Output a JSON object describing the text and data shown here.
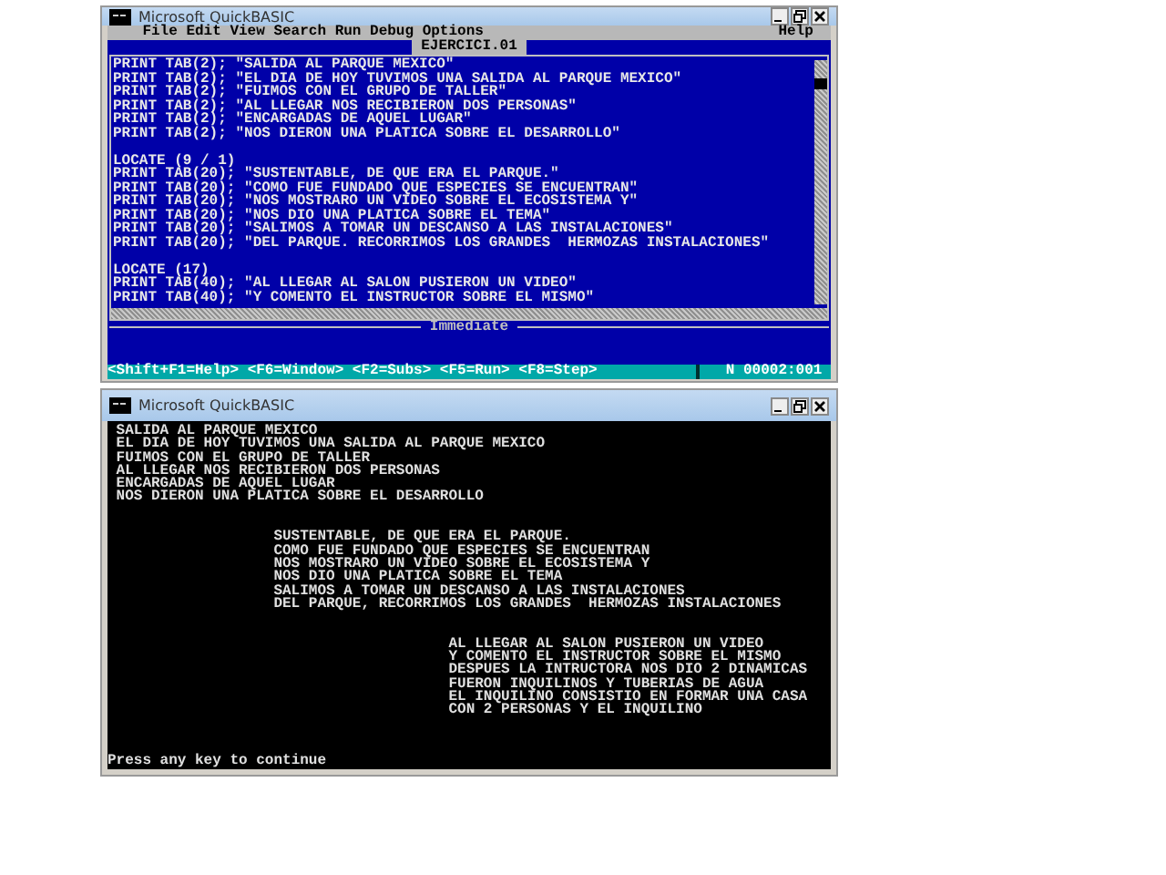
{
  "editor_window": {
    "title": "Microsoft QuickBASIC",
    "menu": [
      "File",
      "Edit",
      "View",
      "Search",
      "Run",
      "Debug",
      "Options"
    ],
    "help_menu": "Help",
    "file_tab": "EJERCICI.01",
    "code_blocks": [
      [
        "PRINT TAB(2); \"SALIDA AL PARQUE MEXICO\"",
        "PRINT TAB(2); \"EL DIA DE HOY TUVIMOS UNA SALIDA AL PARQUE MEXICO\"",
        "PRINT TAB(2); \"FUIMOS CON EL GRUPO DE TALLER\"",
        "PRINT TAB(2); \"AL LLEGAR NOS RECIBIERON DOS PERSONAS\"",
        "PRINT TAB(2); \"ENCARGADAS DE AQUEL LUGAR\"",
        "PRINT TAB(2); \"NOS DIERON UNA PLATICA SOBRE EL DESARROLLO\""
      ],
      [
        "LOCATE (9 / 1)",
        "PRINT TAB(20); \"SUSTENTABLE, DE QUE ERA EL PARQUE.\"",
        "PRINT TAB(20); \"COMO FUE FUNDADO QUE ESPECIES SE ENCUENTRAN\"",
        "PRINT TAB(20); \"NOS MOSTRARO UN VIDEO SOBRE EL ECOSISTEMA Y\"",
        "PRINT TAB(20); \"NOS DIO UNA PLATICA SOBRE EL TEMA\"",
        "PRINT TAB(20); \"SALIMOS A TOMAR UN DESCANSO A LAS INSTALACIONES\"",
        "PRINT TAB(20); \"DEL PARQUE. RECORRIMOS LOS GRANDES  HERMOZAS INSTALACIONES\""
      ],
      [
        "LOCATE (17)",
        "PRINT TAB(40); \"AL LLEGAR AL SALON PUSIERON UN VIDEO\"",
        "PRINT TAB(40); \"Y COMENTO EL INSTRUCTOR SOBRE EL MISMO\""
      ]
    ],
    "immediate_label": "Immediate",
    "status_keys": "<Shift+F1=Help> <F6=Window> <F2=Subs> <F5=Run> <F8=Step>",
    "status_position": "N 00002:001"
  },
  "output_window": {
    "title": "Microsoft QuickBASIC",
    "output_blocks": [
      {
        "kind": "tab2",
        "lines": [
          "SALIDA AL PARQUE MEXICO",
          "EL DIA DE HOY TUVIMOS UNA SALIDA AL PARQUE MEXICO",
          "FUIMOS CON EL GRUPO DE TALLER",
          "AL LLEGAR NOS RECIBIERON DOS PERSONAS",
          "ENCARGADAS DE AQUEL LUGAR",
          "NOS DIERON UNA PLATICA SOBRE EL DESARROLLO"
        ]
      },
      {
        "kind": "tab20",
        "lines": [
          "SUSTENTABLE, DE QUE ERA EL PARQUE.",
          "COMO FUE FUNDADO QUE ESPECIES SE ENCUENTRAN",
          "NOS MOSTRARO UN VIDEO SOBRE EL ECOSISTEMA Y",
          "NOS DIO UNA PLATICA SOBRE EL TEMA",
          "SALIMOS A TOMAR UN DESCANSO A LAS INSTALACIONES",
          "DEL PARQUE, RECORRIMOS LOS GRANDES  HERMOZAS INSTALACIONES"
        ]
      },
      {
        "kind": "tab40",
        "lines": [
          "AL LLEGAR AL SALON PUSIERON UN VIDEO",
          "Y COMENTO EL INSTRUCTOR SOBRE EL MISMO",
          "DESPUES LA INTRUCTORA NOS DIO 2 DINAMICAS",
          "FUERON INQUILINOS Y TUBERIAS DE AGUA",
          "EL INQUILINO CONSISTIO EN FORMAR UNA CASA",
          "CON 2 PERSONAS Y EL INQUILINO"
        ]
      }
    ],
    "prompt": "Press any key to continue"
  }
}
